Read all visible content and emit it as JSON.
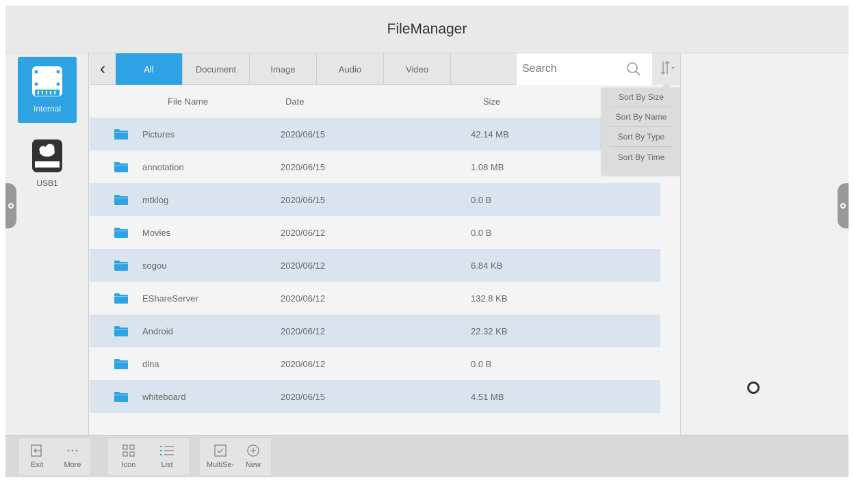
{
  "app": {
    "title": "FileManager"
  },
  "drives": [
    {
      "label": "Internal",
      "active": true
    },
    {
      "label": "USB1",
      "active": false
    }
  ],
  "tabs": [
    {
      "label": "All",
      "active": true
    },
    {
      "label": "Document",
      "active": false
    },
    {
      "label": "Image",
      "active": false
    },
    {
      "label": "Audio",
      "active": false
    },
    {
      "label": "Video",
      "active": false
    }
  ],
  "search": {
    "placeholder": "Search",
    "value": ""
  },
  "columns": {
    "name": "File Name",
    "date": "Date",
    "size": "Size"
  },
  "files": [
    {
      "name": "Pictures",
      "date": "2020/06/15",
      "size": "42.14 MB"
    },
    {
      "name": "annotation",
      "date": "2020/06/15",
      "size": "1.08 MB"
    },
    {
      "name": "mtklog",
      "date": "2020/06/15",
      "size": "0.0 B"
    },
    {
      "name": "Movies",
      "date": "2020/06/12",
      "size": "0.0 B"
    },
    {
      "name": "sogou",
      "date": "2020/06/12",
      "size": "6.84 KB"
    },
    {
      "name": "EShareServer",
      "date": "2020/06/12",
      "size": "132.8 KB"
    },
    {
      "name": "Android",
      "date": "2020/06/12",
      "size": "22.32 KB"
    },
    {
      "name": "dlna",
      "date": "2020/06/12",
      "size": "0.0 B"
    },
    {
      "name": "whiteboard",
      "date": "2020/06/15",
      "size": "4.51 MB"
    }
  ],
  "sort_menu": [
    {
      "label": "Sort By Size"
    },
    {
      "label": "Sort By Name"
    },
    {
      "label": "Sort By Type"
    },
    {
      "label": "Sort By Time"
    }
  ],
  "toolbar": {
    "exit": "Exit",
    "more": "More",
    "icon": "Icon",
    "list": "List",
    "multiselect": "MultiSe-",
    "new": "New"
  },
  "colors": {
    "accent": "#2da3e3",
    "row_stripe": "#d9e4ee",
    "folder": "#2da3e3"
  }
}
